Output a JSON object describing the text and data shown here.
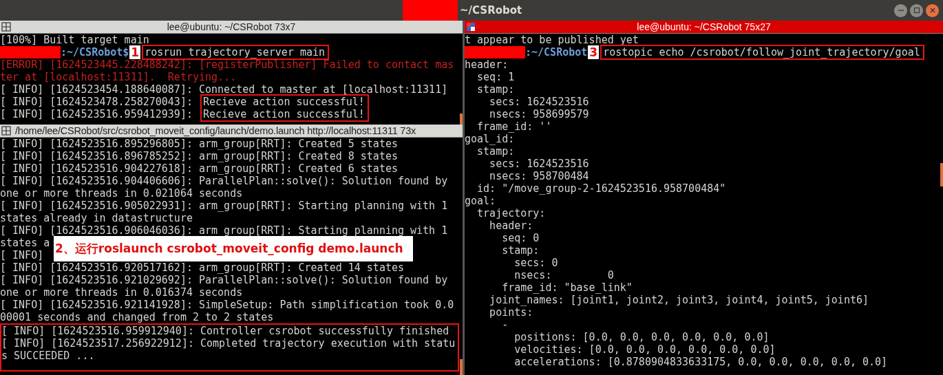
{
  "window": {
    "title": "~/CSRobot",
    "title_redacted": true
  },
  "columns": [
    {
      "panes": [
        {
          "title": "lee@ubuntu: ~/CSRobot 73x7",
          "active": false,
          "blocks": [
            {
              "boxed": false,
              "lines": [
                {
                  "kind": "output",
                  "text": "[100%] Built target main"
                }
              ]
            },
            {
              "boxed": true,
              "leads": [
                {
                  "kind": "prompt",
                  "redacted": true,
                  "text": ":~/CSRobot$",
                  "marker": "1"
                }
              ],
              "lines": [
                {
                  "kind": "output",
                  "text": "rosrun trajectory_server main"
                }
              ]
            },
            {
              "boxed": false,
              "lines": [
                {
                  "kind": "error",
                  "text": "[ERROR] [1624523445.228488242]: [registerPublisher] Failed to contact mas"
                },
                {
                  "kind": "error",
                  "text": "ter at [localhost:11311].  Retrying..."
                },
                {
                  "kind": "output",
                  "text": "[ INFO] [1624523454.188640087]: Connected to master at [localhost:11311]"
                }
              ]
            },
            {
              "boxed": true,
              "leads": [
                {
                  "kind": "output",
                  "text": "[ INFO] [1624523478.258270043]: "
                },
                {
                  "kind": "output",
                  "text": "[ INFO] [1624523516.959412939]: "
                }
              ],
              "lines": [
                {
                  "kind": "output",
                  "text": "Recieve action successful!"
                },
                {
                  "kind": "output",
                  "text": "Recieve action successful!"
                }
              ]
            }
          ]
        },
        {
          "title": "/home/lee/CSRobot/src/csrobot_moveit_config/launch/demo.launch http://localhost:11311 73x",
          "active": false,
          "callout": "2、运行roslaunch csrobot_moveit_config demo.launch",
          "blocks": [
            {
              "boxed": false,
              "lines": [
                {
                  "kind": "output",
                  "text": "[ INFO] [1624523516.895296805]: arm_group[RRT]: Created 5 states"
                },
                {
                  "kind": "output",
                  "text": "[ INFO] [1624523516.896785252]: arm_group[RRT]: Created 8 states"
                },
                {
                  "kind": "output",
                  "text": "[ INFO] [1624523516.904227618]: arm_group[RRT]: Created 6 states"
                },
                {
                  "kind": "output",
                  "text": "[ INFO] [1624523516.904406606]: ParallelPlan::solve(): Solution found by"
                },
                {
                  "kind": "output",
                  "text": "one or more threads in 0.021064 seconds"
                },
                {
                  "kind": "output",
                  "text": "[ INFO] [1624523516.905022931]: arm_group[RRT]: Starting planning with 1"
                },
                {
                  "kind": "output",
                  "text": "states already in datastructure"
                },
                {
                  "kind": "output",
                  "text": "[ INFO] [1624523516.906046036]: arm_group[RRT]: Starting planning with 1"
                },
                {
                  "kind": "output",
                  "text": "states a"
                },
                {
                  "kind": "output",
                  "text": "[ INFO]"
                },
                {
                  "kind": "output",
                  "text": "[ INFO] [1624523516.920517162]: arm_group[RRT]: Created 14 states"
                },
                {
                  "kind": "output",
                  "text": "[ INFO] [1624523516.921029692]: ParallelPlan::solve(): Solution found by"
                },
                {
                  "kind": "output",
                  "text": "one or more threads in 0.016374 seconds"
                },
                {
                  "kind": "output",
                  "text": "[ INFO] [1624523516.921141928]: SimpleSetup: Path simplification took 0.0"
                },
                {
                  "kind": "output",
                  "text": "00001 seconds and changed from 2 to 2 states"
                }
              ]
            },
            {
              "boxed": true,
              "lines": [
                {
                  "kind": "output",
                  "text": "[ INFO] [1624523516.959912940]: Controller csrobot successfully finished"
                },
                {
                  "kind": "output",
                  "text": "[ INFO] [1624523517.256922912]: Completed trajectory execution with statu"
                },
                {
                  "kind": "output",
                  "text": "s SUCCEEDED ..."
                }
              ]
            }
          ]
        }
      ]
    },
    {
      "panes": [
        {
          "title": "lee@ubuntu: ~/CSRobot 75x27",
          "active": true,
          "blocks": [
            {
              "boxed": false,
              "lines": [
                {
                  "kind": "output",
                  "text": "t appear to be published yet"
                }
              ]
            },
            {
              "boxed": true,
              "leads": [
                {
                  "kind": "prompt",
                  "redacted": true,
                  "text": ":~/CSRobot",
                  "marker": "3"
                }
              ],
              "lines": [
                {
                  "kind": "output",
                  "text": "rostopic echo /csrobot/follow_joint_trajectory/goal"
                }
              ]
            },
            {
              "boxed": false,
              "lines": [
                {
                  "kind": "output",
                  "text": "header:"
                },
                {
                  "kind": "output",
                  "text": "  seq: 1"
                },
                {
                  "kind": "output",
                  "text": "  stamp:"
                },
                {
                  "kind": "output",
                  "text": "    secs: 1624523516"
                },
                {
                  "kind": "output",
                  "text": "    nsecs: 958699579"
                },
                {
                  "kind": "output",
                  "text": "  frame_id: ''"
                },
                {
                  "kind": "output",
                  "text": "goal_id:"
                },
                {
                  "kind": "output",
                  "text": "  stamp:"
                },
                {
                  "kind": "output",
                  "text": "    secs: 1624523516"
                },
                {
                  "kind": "output",
                  "text": "    nsecs: 958700484"
                },
                {
                  "kind": "output",
                  "text": "  id: \"/move_group-2-1624523516.958700484\""
                },
                {
                  "kind": "output",
                  "text": "goal:"
                },
                {
                  "kind": "output",
                  "text": "  trajectory:"
                },
                {
                  "kind": "output",
                  "text": "    header:"
                },
                {
                  "kind": "output",
                  "text": "      seq: 0"
                },
                {
                  "kind": "output",
                  "text": "      stamp:"
                },
                {
                  "kind": "output",
                  "text": "        secs: 0"
                },
                {
                  "kind": "output",
                  "text": "        nsecs:         0"
                },
                {
                  "kind": "output",
                  "text": "      frame_id: \"base_link\""
                },
                {
                  "kind": "output",
                  "text": "    joint_names: [joint1, joint2, joint3, joint4, joint5, joint6]"
                },
                {
                  "kind": "output",
                  "text": "    points:"
                },
                {
                  "kind": "output",
                  "text": "      -"
                },
                {
                  "kind": "output",
                  "text": "        positions: [0.0, 0.0, 0.0, 0.0, 0.0, 0.0]"
                },
                {
                  "kind": "output",
                  "text": "        velocities: [0.0, 0.0, 0.0, 0.0, 0.0, 0.0]"
                },
                {
                  "kind": "output",
                  "text": "        accelerations: [0.8780904833633175, 0.0, 0.0, 0.0, 0.0, 0.0]"
                }
              ]
            }
          ]
        }
      ]
    }
  ]
}
